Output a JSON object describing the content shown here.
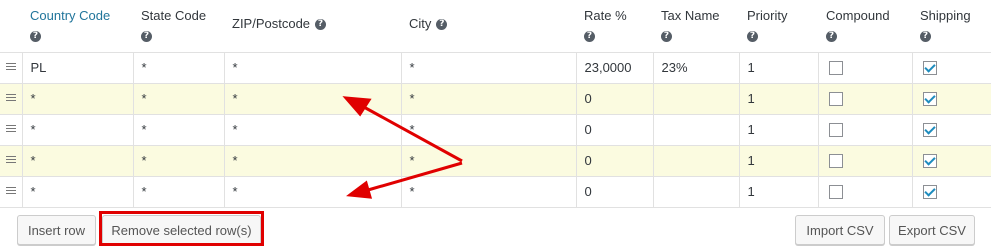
{
  "columns": [
    {
      "label": "Country Code",
      "help_icon": "help-icon"
    },
    {
      "label": "State Code",
      "help_icon": "help-icon"
    },
    {
      "label": "ZIP/Postcode",
      "help_icon": "help-icon"
    },
    {
      "label": "City",
      "help_icon": "help-icon"
    },
    {
      "label": "Rate %",
      "help_icon": "help-icon"
    },
    {
      "label": "Tax Name",
      "help_icon": "help-icon"
    },
    {
      "label": "Priority",
      "help_icon": "help-icon"
    },
    {
      "label": "Compound",
      "help_icon": "help-icon"
    },
    {
      "label": "Shipping",
      "help_icon": "help-icon"
    }
  ],
  "help_glyph": "?",
  "rows": [
    {
      "country": "PL",
      "state": "*",
      "zip": "*",
      "city": "*",
      "rate": "23,0000",
      "name": "23%",
      "priority": "1",
      "compound": false,
      "shipping": true
    },
    {
      "country": "*",
      "state": "*",
      "zip": "*",
      "city": "*",
      "rate": "0",
      "name": "",
      "priority": "1",
      "compound": false,
      "shipping": true
    },
    {
      "country": "*",
      "state": "*",
      "zip": "*",
      "city": "*",
      "rate": "0",
      "name": "",
      "priority": "1",
      "compound": false,
      "shipping": true
    },
    {
      "country": "*",
      "state": "*",
      "zip": "*",
      "city": "*",
      "rate": "0",
      "name": "",
      "priority": "1",
      "compound": false,
      "shipping": true
    },
    {
      "country": "*",
      "state": "*",
      "zip": "*",
      "city": "*",
      "rate": "0",
      "name": "",
      "priority": "1",
      "compound": false,
      "shipping": true
    }
  ],
  "buttons": {
    "insert_row": "Insert row",
    "remove_rows": "Remove selected row(s)",
    "import_csv": "Import CSV",
    "export_csv": "Export CSV"
  },
  "colors": {
    "header_link": "#21759b",
    "row_highlight": "#fbfbe0",
    "annotation_red": "#e00000",
    "checkbox_check": "#1e8cbe"
  },
  "annotation": {
    "highlighted_element": "remove-selected-rows-button",
    "arrows_point_to": [
      "row-2",
      "row-5"
    ]
  }
}
